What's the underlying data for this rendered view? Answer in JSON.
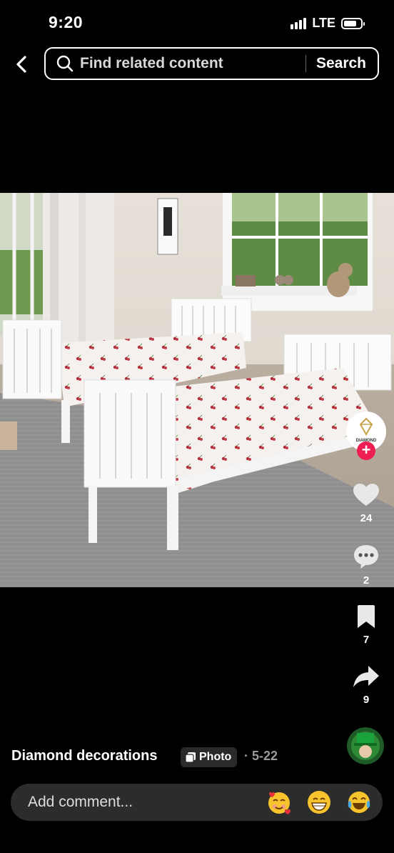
{
  "status_bar": {
    "time": "9:20",
    "network": "LTE",
    "battery_level": 0.7
  },
  "search": {
    "placeholder": "Find related content",
    "button_label": "Search"
  },
  "post": {
    "author": "Diamond decorations",
    "type_badge": "Photo",
    "date": "· 5-22",
    "avatar_label": "DIAMOND"
  },
  "actions": {
    "likes": "24",
    "comments": "2",
    "saves": "7",
    "shares": "9"
  },
  "comment_bar": {
    "placeholder": "Add comment...",
    "emojis": [
      "🥰",
      "😁",
      "😂"
    ]
  },
  "colors": {
    "background": "#000000",
    "follow_accent": "#ee1d52",
    "comment_bar": "#2c2c2c"
  }
}
